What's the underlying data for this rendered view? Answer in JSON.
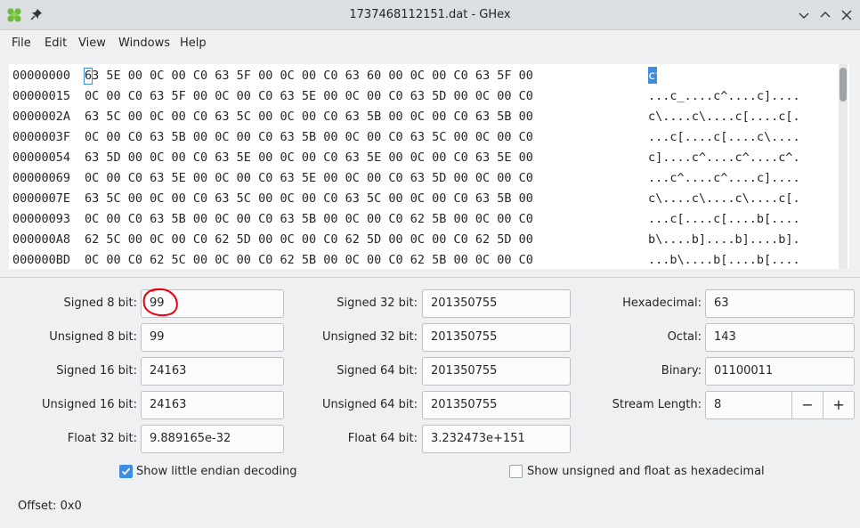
{
  "window": {
    "title": "1737468112151.dat - GHex"
  },
  "menu": [
    "File",
    "Edit",
    "View",
    "Windows",
    "Help"
  ],
  "hex_rows": [
    {
      "offset": "00000000",
      "hex": "63 5E 00 0C 00 C0 63 5F 00 0C 00 C0 63 60 00 0C 00 C0 63 5F 00",
      "ascii": "c^....c_....c`....c_."
    },
    {
      "offset": "00000015",
      "hex": "0C 00 C0 63 5F 00 0C 00 C0 63 5E 00 0C 00 C0 63 5D 00 0C 00 C0",
      "ascii": "...c_....c^....c]...."
    },
    {
      "offset": "0000002A",
      "hex": "63 5C 00 0C 00 C0 63 5C 00 0C 00 C0 63 5B 00 0C 00 C0 63 5B 00",
      "ascii": "c\\....c\\....c[....c[."
    },
    {
      "offset": "0000003F",
      "hex": "0C 00 C0 63 5B 00 0C 00 C0 63 5B 00 0C 00 C0 63 5C 00 0C 00 C0",
      "ascii": "...c[....c[....c\\...."
    },
    {
      "offset": "00000054",
      "hex": "63 5D 00 0C 00 C0 63 5E 00 0C 00 C0 63 5E 00 0C 00 C0 63 5E 00",
      "ascii": "c]....c^....c^....c^."
    },
    {
      "offset": "00000069",
      "hex": "0C 00 C0 63 5E 00 0C 00 C0 63 5E 00 0C 00 C0 63 5D 00 0C 00 C0",
      "ascii": "...c^....c^....c]...."
    },
    {
      "offset": "0000007E",
      "hex": "63 5C 00 0C 00 C0 63 5C 00 0C 00 C0 63 5C 00 0C 00 C0 63 5B 00",
      "ascii": "c\\....c\\....c\\....c[."
    },
    {
      "offset": "00000093",
      "hex": "0C 00 C0 63 5B 00 0C 00 C0 63 5B 00 0C 00 C0 62 5B 00 0C 00 C0",
      "ascii": "...c[....c[....b[...."
    },
    {
      "offset": "000000A8",
      "hex": "62 5C 00 0C 00 C0 62 5D 00 0C 00 C0 62 5D 00 0C 00 C0 62 5D 00",
      "ascii": "b\\....b]....b]....b]."
    },
    {
      "offset": "000000BD",
      "hex": "0C 00 C0 62 5C 00 0C 00 C0 62 5B 00 0C 00 C0 62 5B 00 0C 00 C0",
      "ascii": "...b\\....b[....b[...."
    }
  ],
  "decoder": {
    "signed8": {
      "label": "Signed 8 bit:",
      "value": "99"
    },
    "unsigned8": {
      "label": "Unsigned 8 bit:",
      "value": "99"
    },
    "signed16": {
      "label": "Signed 16 bit:",
      "value": "24163"
    },
    "unsigned16": {
      "label": "Unsigned 16 bit:",
      "value": "24163"
    },
    "float32": {
      "label": "Float 32 bit:",
      "value": "9.889165e-32"
    },
    "signed32": {
      "label": "Signed 32 bit:",
      "value": "201350755"
    },
    "unsigned32": {
      "label": "Unsigned 32 bit:",
      "value": "201350755"
    },
    "signed64": {
      "label": "Signed 64 bit:",
      "value": "201350755"
    },
    "unsigned64": {
      "label": "Unsigned 64 bit:",
      "value": "201350755"
    },
    "float64": {
      "label": "Float 64 bit:",
      "value": "3.232473e+151"
    },
    "hexadecimal": {
      "label": "Hexadecimal:",
      "value": "63"
    },
    "octal": {
      "label": "Octal:",
      "value": "143"
    },
    "binary": {
      "label": "Binary:",
      "value": "01100011"
    },
    "stream_length": {
      "label": "Stream Length:",
      "value": "8",
      "minus": "−",
      "plus": "+"
    }
  },
  "options": {
    "little_endian": {
      "label": "Show little endian decoding",
      "checked": true
    },
    "unsigned_float_hex": {
      "label": "Show unsigned and float as hexadecimal",
      "checked": false
    }
  },
  "status": {
    "offset": "Offset: 0x0"
  },
  "colors": {
    "accent": "#3d8de0",
    "annotation": "#e8000b"
  }
}
